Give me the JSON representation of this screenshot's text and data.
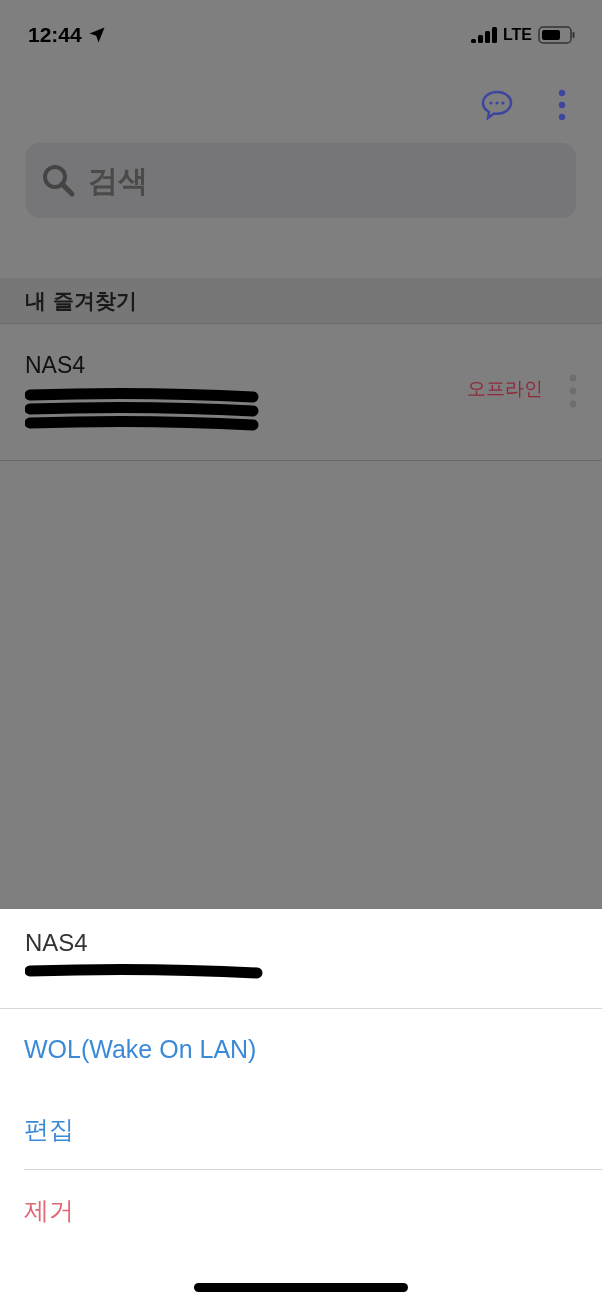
{
  "status_bar": {
    "time": "12:44",
    "network": "LTE"
  },
  "search": {
    "placeholder": "검색"
  },
  "section": {
    "title": "내 즐겨찾기"
  },
  "favorites": [
    {
      "name": "NAS4",
      "status": "오프라인"
    }
  ],
  "sheet": {
    "title": "NAS4",
    "action_groups": [
      [
        {
          "label": "WOL(Wake On LAN)",
          "kind": "default"
        },
        {
          "label": "편집",
          "kind": "default"
        }
      ],
      [
        {
          "label": "제거",
          "kind": "destructive"
        }
      ]
    ]
  }
}
